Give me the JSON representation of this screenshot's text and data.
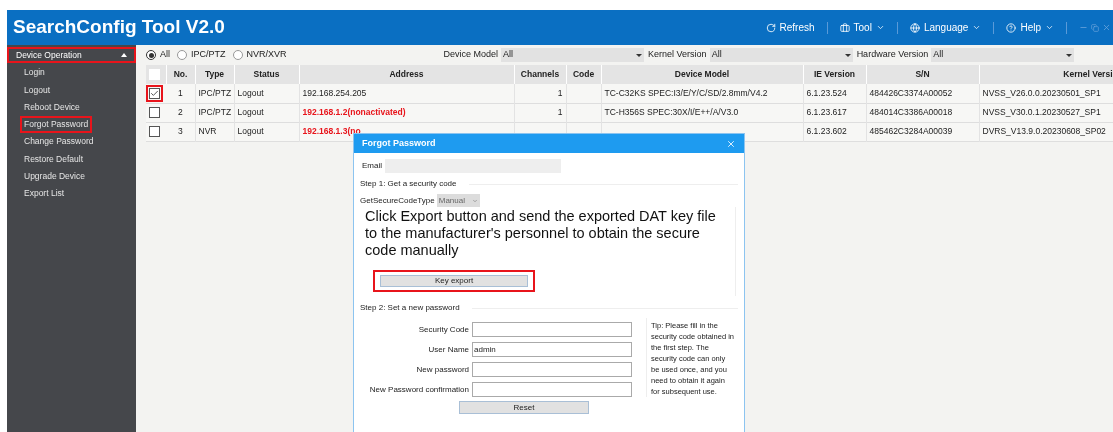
{
  "window": {
    "title": "SearchConfig Tool V2.0",
    "menu": [
      {
        "label": "Refresh",
        "kind": "action"
      },
      {
        "label": "Tool",
        "kind": "dropdown"
      },
      {
        "label": "Language",
        "kind": "dropdown"
      },
      {
        "label": "Help",
        "kind": "dropdown"
      }
    ]
  },
  "sidebar": {
    "group": {
      "label": "Device Operation",
      "expanded": true,
      "highlighted": true
    },
    "items": [
      {
        "label": "Login",
        "highlighted": false
      },
      {
        "label": "Logout",
        "highlighted": false
      },
      {
        "label": "Reboot Device",
        "highlighted": false
      },
      {
        "label": "Forgot Password",
        "highlighted": true
      },
      {
        "label": "Change Password",
        "highlighted": false
      },
      {
        "label": "Restore Default",
        "highlighted": false
      },
      {
        "label": "Upgrade Device",
        "highlighted": false
      },
      {
        "label": "Export List",
        "highlighted": false
      }
    ]
  },
  "filters": {
    "types": [
      {
        "label": "All",
        "selected": true
      },
      {
        "label": "IPC/PTZ",
        "selected": false
      },
      {
        "label": "NVR/XVR",
        "selected": false
      }
    ],
    "dropdowns": [
      {
        "label": "Device Model",
        "value": "All"
      },
      {
        "label": "Kernel Version",
        "value": "All"
      },
      {
        "label": "Hardware Version",
        "value": "All"
      }
    ]
  },
  "table": {
    "select_all": {
      "checked": false
    },
    "columns": [
      "No.",
      "Type",
      "Status",
      "Address",
      "Channels",
      "Code",
      "Device Model",
      "IE Version",
      "S/N",
      "Kernel Versi"
    ],
    "rows": [
      {
        "checked": true,
        "highlighted": true,
        "nonactivated": false,
        "cells": [
          "1",
          "IPC/PTZ",
          "Logout",
          "192.168.254.205",
          "1",
          "",
          "TC-C32KS SPEC:I3/E/Y/C/SD/2.8mm/V4.2",
          "6.1.23.524",
          "484426C3374A00052",
          "NVSS_V26.0.0.20230501_SP1"
        ]
      },
      {
        "checked": false,
        "highlighted": false,
        "nonactivated": true,
        "cells": [
          "2",
          "IPC/PTZ",
          "Logout",
          "192.168.1.2(nonactivated)",
          "1",
          "",
          "TC-H356S SPEC:30X/I/E++/A/V3.0",
          "6.1.23.617",
          "484014C3386A00018",
          "NVSS_V30.0.1.20230527_SP1"
        ]
      },
      {
        "checked": false,
        "highlighted": false,
        "nonactivated": true,
        "cells": [
          "3",
          "NVR",
          "Logout",
          "192.168.1.3(no",
          "",
          "",
          "",
          "6.1.23.602",
          "485462C3284A00039",
          "DVRS_V13.9.0.20230608_SP02"
        ]
      }
    ]
  },
  "dialog": {
    "title": "Forgot Password",
    "email": {
      "label": "Email",
      "disabled": true
    },
    "step1": {
      "label": "Step 1: Get a security code",
      "code_type_label": "GetSecureCodeType",
      "code_type_value": "Manual",
      "code_type_disabled": true,
      "message": "Click Export button and send the exported DAT key file to the manufacturer's personnel to obtain the secure code manually",
      "button": {
        "label": "Key export",
        "highlighted": true
      }
    },
    "step2": {
      "label": "Step 2: Set a new password",
      "fields": [
        {
          "label": "Security Code"
        },
        {
          "label": "User Name",
          "value": "admin"
        },
        {
          "label": "New password"
        },
        {
          "label": "New Password confirmation"
        }
      ],
      "tip": "Tip: Please fill in the security code obtained in the first step. The security code can only be used once, and you need to obtain it again for subsequent use.",
      "button": "Reset"
    }
  }
}
